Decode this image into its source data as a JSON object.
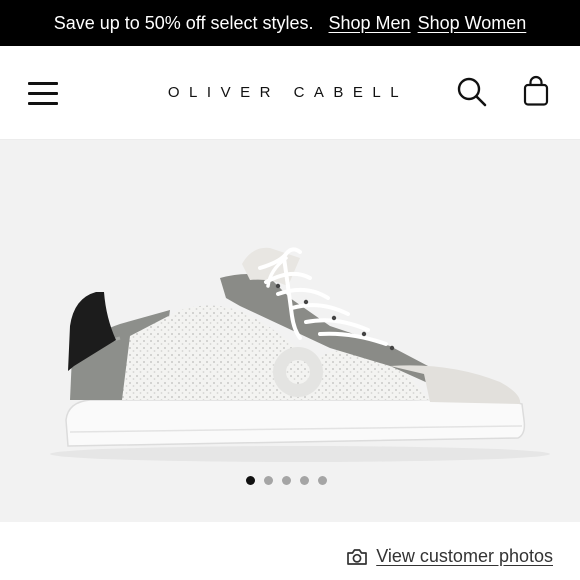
{
  "promo": {
    "text": "Save up to 50% off select styles.",
    "links": [
      "Shop Men",
      "Shop Women"
    ]
  },
  "header": {
    "logo": "OLIVER CABELL",
    "icons": [
      "menu-icon",
      "search-icon",
      "shopping-bag-icon"
    ]
  },
  "gallery": {
    "image": "sneaker-product-photo",
    "slide_count": 5,
    "active_slide": 1
  },
  "customer_photos": {
    "icon": "camera-icon",
    "label": "View customer photos"
  },
  "colors": {
    "promo_bg": "#000000",
    "gallery_bg": "#f2f2f2",
    "active_dot": "#111111",
    "inactive_dot": "#a5a5a5"
  }
}
